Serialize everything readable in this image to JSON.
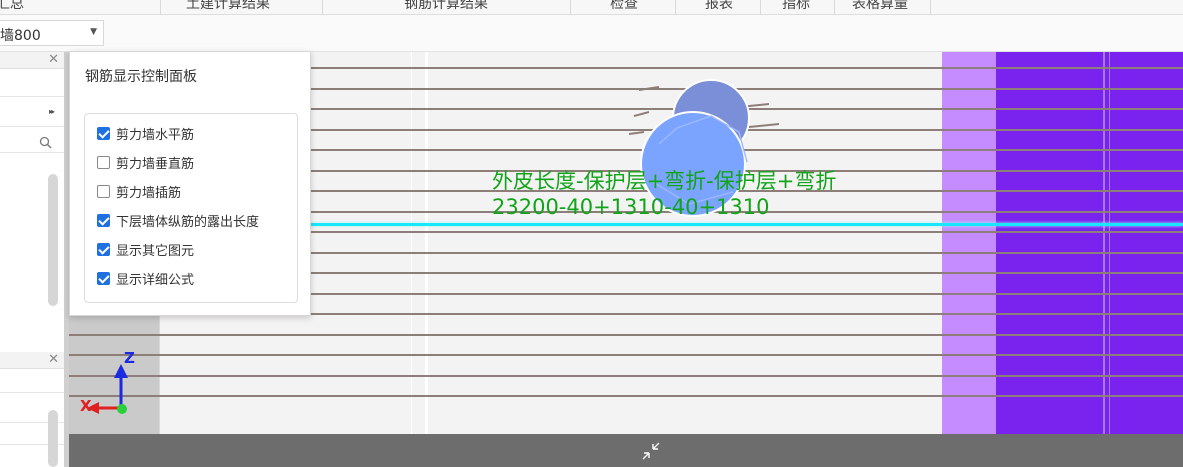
{
  "top_tabs": [
    {
      "label": "汇总",
      "name": "tab-summary"
    },
    {
      "label": "土建计算结果",
      "name": "tab-civil-results"
    },
    {
      "label": "钢筋计算结果",
      "name": "tab-rebar-results"
    },
    {
      "label": "检查",
      "name": "tab-check"
    },
    {
      "label": "报表",
      "name": "tab-reports"
    },
    {
      "label": "指标",
      "name": "tab-indicators"
    },
    {
      "label": "表格算量",
      "name": "tab-table-quantity"
    }
  ],
  "component_select": {
    "value": "墙800"
  },
  "left_panel": {
    "collapse_glyph": "▸▸"
  },
  "rebar_panel": {
    "title": "钢筋显示控制面板",
    "options": [
      {
        "label": "剪力墙水平筋",
        "checked": true
      },
      {
        "label": "剪力墙垂直筋",
        "checked": false
      },
      {
        "label": "剪力墙插筋",
        "checked": false
      },
      {
        "label": "下层墙体纵筋的露出长度",
        "checked": true
      },
      {
        "label": "显示其它图元",
        "checked": true
      },
      {
        "label": "显示详细公式",
        "checked": true
      }
    ]
  },
  "formula": {
    "line1": "外皮长度-保护层+弯折-保护层+弯折",
    "line2": "23200-40+1310-40+1310"
  },
  "axes": {
    "z_label": "Z",
    "x_label": "X"
  },
  "colors": {
    "formula_green": "#11a418",
    "highlight_cyan": "#19e6ff",
    "wall_purple": "#7a22ee",
    "wall_pale_purple": "#c48cff",
    "checkbox_blue": "#1f70e0"
  }
}
